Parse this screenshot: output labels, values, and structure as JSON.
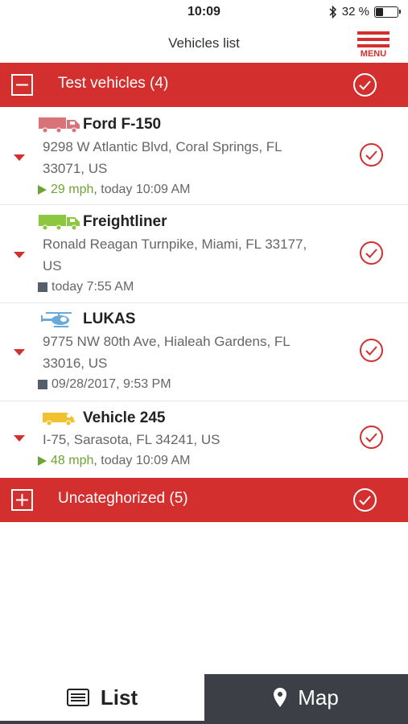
{
  "status_bar": {
    "time": "10:09",
    "battery_percent": "32 %",
    "battery_level": 0.32
  },
  "nav": {
    "title": "Vehicles list",
    "menu_label": "MENU"
  },
  "groups": [
    {
      "label": "Test vehicles (4)",
      "expanded": true
    },
    {
      "label": "Uncateghorized (5)",
      "expanded": false
    }
  ],
  "vehicles": [
    {
      "name": "Ford F-150",
      "icon": "truck-icon",
      "icon_color": "#d9737a",
      "address_line1": "9298 W Atlantic Blvd, Coral Springs, FL",
      "address_line2": "33071, US",
      "speed": "29 mph",
      "time": ", today 10:09 AM",
      "moving": true
    },
    {
      "name": "Freightliner",
      "icon": "truck-icon",
      "icon_color": "#8dc63f",
      "address_line1": "Ronald Reagan Turnpike, Miami, FL 33177,",
      "address_line2": "US",
      "speed": "",
      "time": "today 7:55 AM",
      "moving": false
    },
    {
      "name": "LUKAS",
      "icon": "helicopter-icon",
      "icon_color": "#6aa9d8",
      "address_line1": "9775 NW 80th Ave, Hialeah Gardens, FL",
      "address_line2": "33016, US",
      "speed": "",
      "time": "09/28/2017, 9:53 PM",
      "moving": false
    },
    {
      "name": "Vehicle 245",
      "icon": "van-icon",
      "icon_color": "#f2c12e",
      "address_line1": "I-75, Sarasota, FL 34241, US",
      "address_line2": "",
      "speed": "48 mph",
      "time": ", today 10:09 AM",
      "moving": true
    }
  ],
  "tabs": {
    "list": "List",
    "map": "Map"
  },
  "colors": {
    "accent": "#d32f2f",
    "speed": "#6ea335",
    "map_tab": "#3c3f45"
  }
}
